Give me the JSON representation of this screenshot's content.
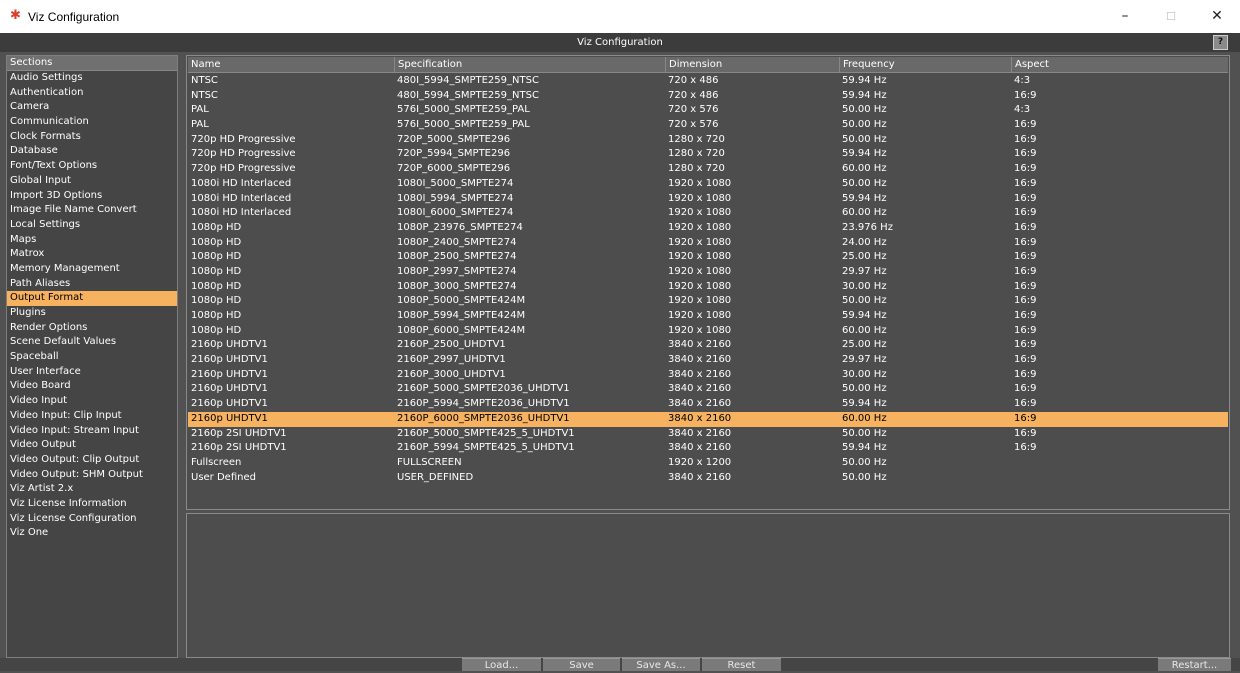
{
  "window": {
    "title": "Viz Configuration",
    "minimize": "–",
    "maximize": "☐",
    "close": "✕"
  },
  "header": {
    "title": "Viz Configuration",
    "help": "?"
  },
  "sidebar": {
    "header": "Sections",
    "selected": "Output Format",
    "items": [
      "Audio Settings",
      "Authentication",
      "Camera",
      "Communication",
      "Clock Formats",
      "Database",
      "Font/Text Options",
      "Global Input",
      "Import 3D Options",
      "Image File Name Convert",
      "Local Settings",
      "Maps",
      "Matrox",
      "Memory Management",
      "Path Aliases",
      "Output Format",
      "Plugins",
      "Render Options",
      "Scene Default Values",
      "Spaceball",
      "User Interface",
      "Video Board",
      "Video Input",
      "Video Input: Clip Input",
      "Video Input: Stream Input",
      "Video Output",
      "Video Output: Clip Output",
      "Video Output: SHM Output",
      "Viz Artist 2.x",
      "Viz License Information",
      "Viz License Configuration",
      "Viz One"
    ]
  },
  "table": {
    "columns": [
      "Name",
      "Specification",
      "Dimension",
      "Frequency",
      "Aspect"
    ],
    "selected_row": 23,
    "rows": [
      [
        "NTSC",
        "480I_5994_SMPTE259_NTSC",
        "720 x 486",
        "59.94 Hz",
        "4:3"
      ],
      [
        "NTSC",
        "480I_5994_SMPTE259_NTSC",
        "720 x 486",
        "59.94 Hz",
        "16:9"
      ],
      [
        "PAL",
        "576I_5000_SMPTE259_PAL",
        "720 x 576",
        "50.00 Hz",
        "4:3"
      ],
      [
        "PAL",
        "576I_5000_SMPTE259_PAL",
        "720 x 576",
        "50.00 Hz",
        "16:9"
      ],
      [
        "720p HD Progressive",
        "720P_5000_SMPTE296",
        "1280 x 720",
        "50.00 Hz",
        "16:9"
      ],
      [
        "720p HD Progressive",
        "720P_5994_SMPTE296",
        "1280 x 720",
        "59.94 Hz",
        "16:9"
      ],
      [
        "720p HD Progressive",
        "720P_6000_SMPTE296",
        "1280 x 720",
        "60.00 Hz",
        "16:9"
      ],
      [
        "1080i HD Interlaced",
        "1080I_5000_SMPTE274",
        "1920 x 1080",
        "50.00 Hz",
        "16:9"
      ],
      [
        "1080i HD Interlaced",
        "1080I_5994_SMPTE274",
        "1920 x 1080",
        "59.94 Hz",
        "16:9"
      ],
      [
        "1080i HD Interlaced",
        "1080I_6000_SMPTE274",
        "1920 x 1080",
        "60.00 Hz",
        "16:9"
      ],
      [
        "1080p HD",
        "1080P_23976_SMPTE274",
        "1920 x 1080",
        "23.976 Hz",
        "16:9"
      ],
      [
        "1080p HD",
        "1080P_2400_SMPTE274",
        "1920 x 1080",
        "24.00 Hz",
        "16:9"
      ],
      [
        "1080p HD",
        "1080P_2500_SMPTE274",
        "1920 x 1080",
        "25.00 Hz",
        "16:9"
      ],
      [
        "1080p HD",
        "1080P_2997_SMPTE274",
        "1920 x 1080",
        "29.97 Hz",
        "16:9"
      ],
      [
        "1080p HD",
        "1080P_3000_SMPTE274",
        "1920 x 1080",
        "30.00 Hz",
        "16:9"
      ],
      [
        "1080p HD",
        "1080P_5000_SMPTE424M",
        "1920 x 1080",
        "50.00 Hz",
        "16:9"
      ],
      [
        "1080p HD",
        "1080P_5994_SMPTE424M",
        "1920 x 1080",
        "59.94 Hz",
        "16:9"
      ],
      [
        "1080p HD",
        "1080P_6000_SMPTE424M",
        "1920 x 1080",
        "60.00 Hz",
        "16:9"
      ],
      [
        "2160p UHDTV1",
        "2160P_2500_UHDTV1",
        "3840 x 2160",
        "25.00 Hz",
        "16:9"
      ],
      [
        "2160p UHDTV1",
        "2160P_2997_UHDTV1",
        "3840 x 2160",
        "29.97 Hz",
        "16:9"
      ],
      [
        "2160p UHDTV1",
        "2160P_3000_UHDTV1",
        "3840 x 2160",
        "30.00 Hz",
        "16:9"
      ],
      [
        "2160p UHDTV1",
        "2160P_5000_SMPTE2036_UHDTV1",
        "3840 x 2160",
        "50.00 Hz",
        "16:9"
      ],
      [
        "2160p UHDTV1",
        "2160P_5994_SMPTE2036_UHDTV1",
        "3840 x 2160",
        "59.94 Hz",
        "16:9"
      ],
      [
        "2160p UHDTV1",
        "2160P_6000_SMPTE2036_UHDTV1",
        "3840 x 2160",
        "60.00 Hz",
        "16:9"
      ],
      [
        "2160p 2SI UHDTV1",
        "2160P_5000_SMPTE425_5_UHDTV1",
        "3840 x 2160",
        "50.00 Hz",
        "16:9"
      ],
      [
        "2160p 2SI UHDTV1",
        "2160P_5994_SMPTE425_5_UHDTV1",
        "3840 x 2160",
        "59.94 Hz",
        "16:9"
      ],
      [
        "Fullscreen",
        "FULLSCREEN",
        "1920 x 1200",
        "50.00 Hz",
        ""
      ],
      [
        "User Defined",
        "USER_DEFINED",
        "3840 x 2160",
        "50.00 Hz",
        ""
      ]
    ]
  },
  "footer": {
    "load": "Load...",
    "save": "Save",
    "save_as": "Save As...",
    "reset": "Reset",
    "restart": "Restart..."
  },
  "colors": {
    "selection": "#f6b25f",
    "background": "#515151"
  }
}
